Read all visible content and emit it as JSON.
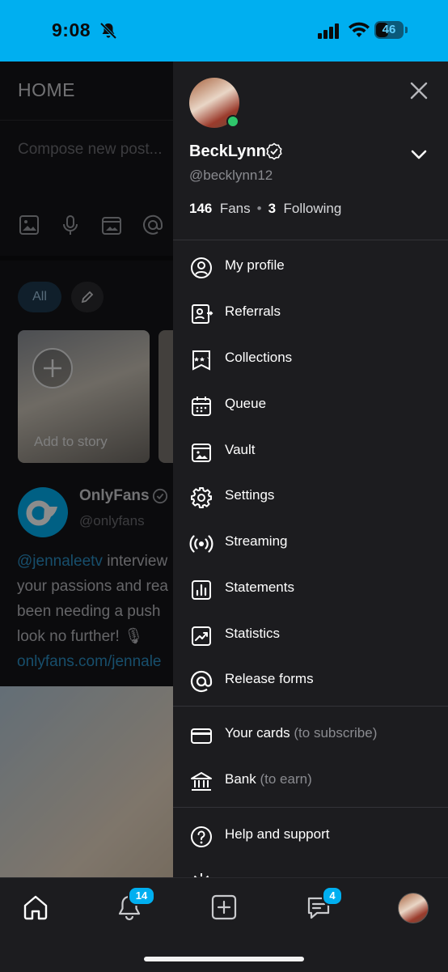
{
  "status_bar": {
    "time": "9:08",
    "battery": "46",
    "battery_level": 0.46
  },
  "feed": {
    "title": "HOME",
    "compose_placeholder": "Compose new post...",
    "filter_all": "All",
    "story_label": "Add to story",
    "post": {
      "author": "OnlyFans",
      "handle": "@onlyfans",
      "mention": "@jennaleetv",
      "line1_rest": " interview",
      "line2": "your passions and rea",
      "line3": "been needing a push",
      "line4": "look no further! 🎙",
      "link": "onlyfans.com/jennale"
    }
  },
  "drawer": {
    "name": "BeckLynn",
    "handle": "@becklynn12",
    "fans_count": "146",
    "fans_label": "Fans",
    "following_count": "3",
    "following_label": "Following",
    "menu": [
      {
        "label": "My profile",
        "icon": "user-circle-icon"
      },
      {
        "label": "Referrals",
        "icon": "referral-icon"
      },
      {
        "label": "Collections",
        "icon": "collections-icon"
      },
      {
        "label": "Queue",
        "icon": "calendar-icon"
      },
      {
        "label": "Vault",
        "icon": "vault-icon"
      },
      {
        "label": "Settings",
        "icon": "gear-icon"
      },
      {
        "label": "Streaming",
        "icon": "streaming-icon"
      },
      {
        "label": "Statements",
        "icon": "statements-icon"
      },
      {
        "label": "Statistics",
        "icon": "statistics-icon"
      },
      {
        "label": "Release forms",
        "icon": "at-icon"
      }
    ],
    "payments": [
      {
        "label": "Your cards",
        "sub": "(to subscribe)",
        "icon": "card-icon"
      },
      {
        "label": "Bank",
        "sub": "(to earn)",
        "icon": "bank-icon"
      }
    ],
    "help": {
      "label": "Help and support",
      "icon": "help-icon"
    }
  },
  "bottom_nav": {
    "notifications_badge": "14",
    "messages_badge": "4"
  },
  "colors": {
    "accent": "#00aff0",
    "drawer_bg": "#1c1c1f",
    "online": "#2fc66b"
  }
}
